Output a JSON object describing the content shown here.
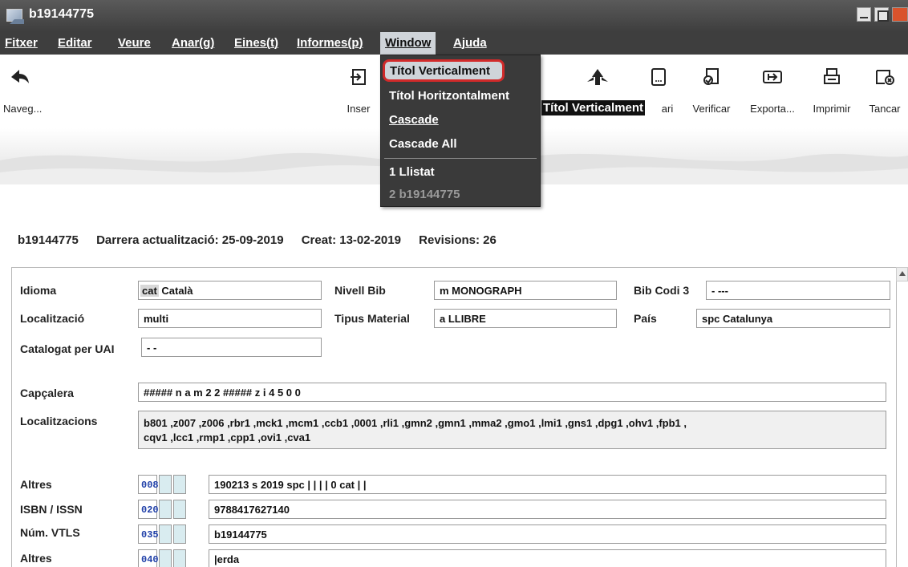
{
  "window": {
    "title": "b19144775"
  },
  "menubar": {
    "items": [
      {
        "label": "Fitxer"
      },
      {
        "label": "Editar"
      },
      {
        "label": "Veure"
      },
      {
        "label": "Anar(g)"
      },
      {
        "label": "Eines(t)"
      },
      {
        "label": "Informes(p)"
      },
      {
        "label": "Window"
      },
      {
        "label": "Ajuda"
      }
    ]
  },
  "window_menu": {
    "items": [
      {
        "label": "Títol Verticalment"
      },
      {
        "label": "Títol Horitzontalment"
      },
      {
        "label": "Cascade"
      },
      {
        "label": "Cascade All"
      },
      {
        "label": "1 Llistat"
      },
      {
        "label": "2 b19144775"
      }
    ]
  },
  "tooltip": "Títol Verticalment",
  "toolbar": {
    "naveg": {
      "label": "Naveg...",
      "icon": "back-arrow-icon"
    },
    "inser": {
      "label": "Inser",
      "icon": "insert-icon"
    },
    "diari": {
      "label": "ari",
      "icon": "glossary-icon"
    },
    "verificar": {
      "label": "Verificar",
      "icon": "verify-icon"
    },
    "exporta": {
      "label": "Exporta...",
      "icon": "export-icon"
    },
    "imprimir": {
      "label": "Imprimir",
      "icon": "printer-icon"
    },
    "tancar": {
      "label": "Tancar",
      "icon": "close-doc-icon"
    }
  },
  "record": {
    "id": "b19144775",
    "updated": "Darrera actualització: 25-09-2019",
    "created": "Creat: 13-02-2019",
    "revisions": "Revisions: 26"
  },
  "fields": {
    "idioma": {
      "label": "Idioma",
      "code": "cat",
      "value": "Català"
    },
    "nivell_bib": {
      "label": "Nivell Bib",
      "value": "m  MONOGRAPH"
    },
    "bib_codi3": {
      "label": "Bib Codi 3",
      "value": "-  ---"
    },
    "localitzacio": {
      "label": "Localització",
      "value": "multi"
    },
    "tipus_material": {
      "label": "Tipus Material",
      "value": "a   LLIBRE"
    },
    "pais": {
      "label": "País",
      "value": "spc  Catalunya"
    },
    "catalogat": {
      "label": "Catalogat per UAI",
      "value": "- -"
    },
    "capcalera": {
      "label": "Capçalera",
      "value": "##### n a m     2 2 ##### z i    4 5 0 0"
    },
    "localitzacions": {
      "label": "Localitzacions",
      "line1": "b801 ,z007 ,z006 ,rbr1 ,mck1 ,mcm1 ,ccb1 ,0001 ,rli1 ,gmn2 ,gmn1 ,mma2 ,gmo1 ,lmi1 ,gns1 ,dpg1 ,ohv1 ,fpb1 ,",
      "line2": "cqv1 ,lcc1 ,rmp1 ,cpp1 ,ovi1 ,cva1"
    }
  },
  "marc_rows": [
    {
      "label": "Altres",
      "tag": "008",
      "value": "190213  s  2019       spc                        |  |  |  |     0    cat  |  |"
    },
    {
      "label": "ISBN / ISSN",
      "tag": "020",
      "value": "9788417627140"
    },
    {
      "label": "Núm. VTLS",
      "tag": "035",
      "value": "b19144775"
    },
    {
      "label": "Altres",
      "tag": "040",
      "value": "|erda"
    }
  ]
}
